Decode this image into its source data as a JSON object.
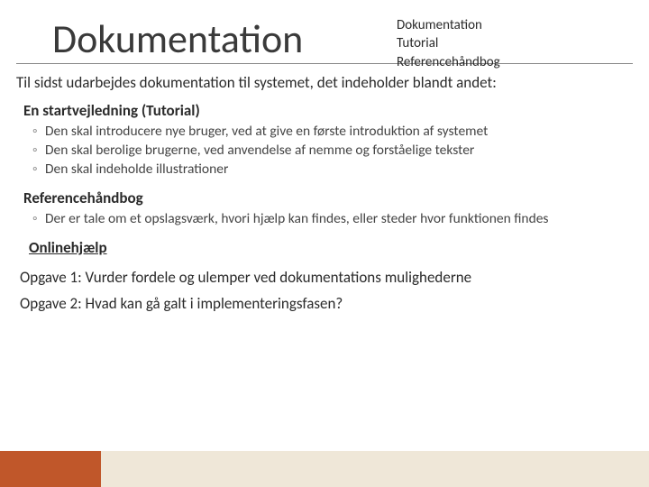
{
  "colors": {
    "accent_orange": "#c0572a",
    "accent_sand": "#efe7d8"
  },
  "header": {
    "title": "Dokumentation",
    "top_right": {
      "line1": "Dokumentation",
      "line2": "Tutorial",
      "line3": "Referencehåndbog"
    }
  },
  "intro": "Til sidst udarbejdes dokumentation til systemet, det indeholder blandt andet:",
  "section1": {
    "heading": "En startvejledning (Tutorial)",
    "bullets": [
      "Den skal introducere nye bruger, ved at give en første introduktion af systemet",
      "Den skal berolige brugerne, ved anvendelse af nemme og forståelige tekster",
      "Den skal indeholde illustrationer"
    ]
  },
  "section2": {
    "heading": "Referencehåndbog",
    "bullets": [
      "Der er tale om et opslagsværk, hvori hjælp kan findes, eller steder hvor funktionen findes"
    ]
  },
  "online": "Onlinehjælp",
  "task1": "Opgave 1: Vurder fordele og ulemper ved dokumentations mulighederne",
  "task2": "Opgave 2: Hvad kan gå galt i implementeringsfasen?"
}
